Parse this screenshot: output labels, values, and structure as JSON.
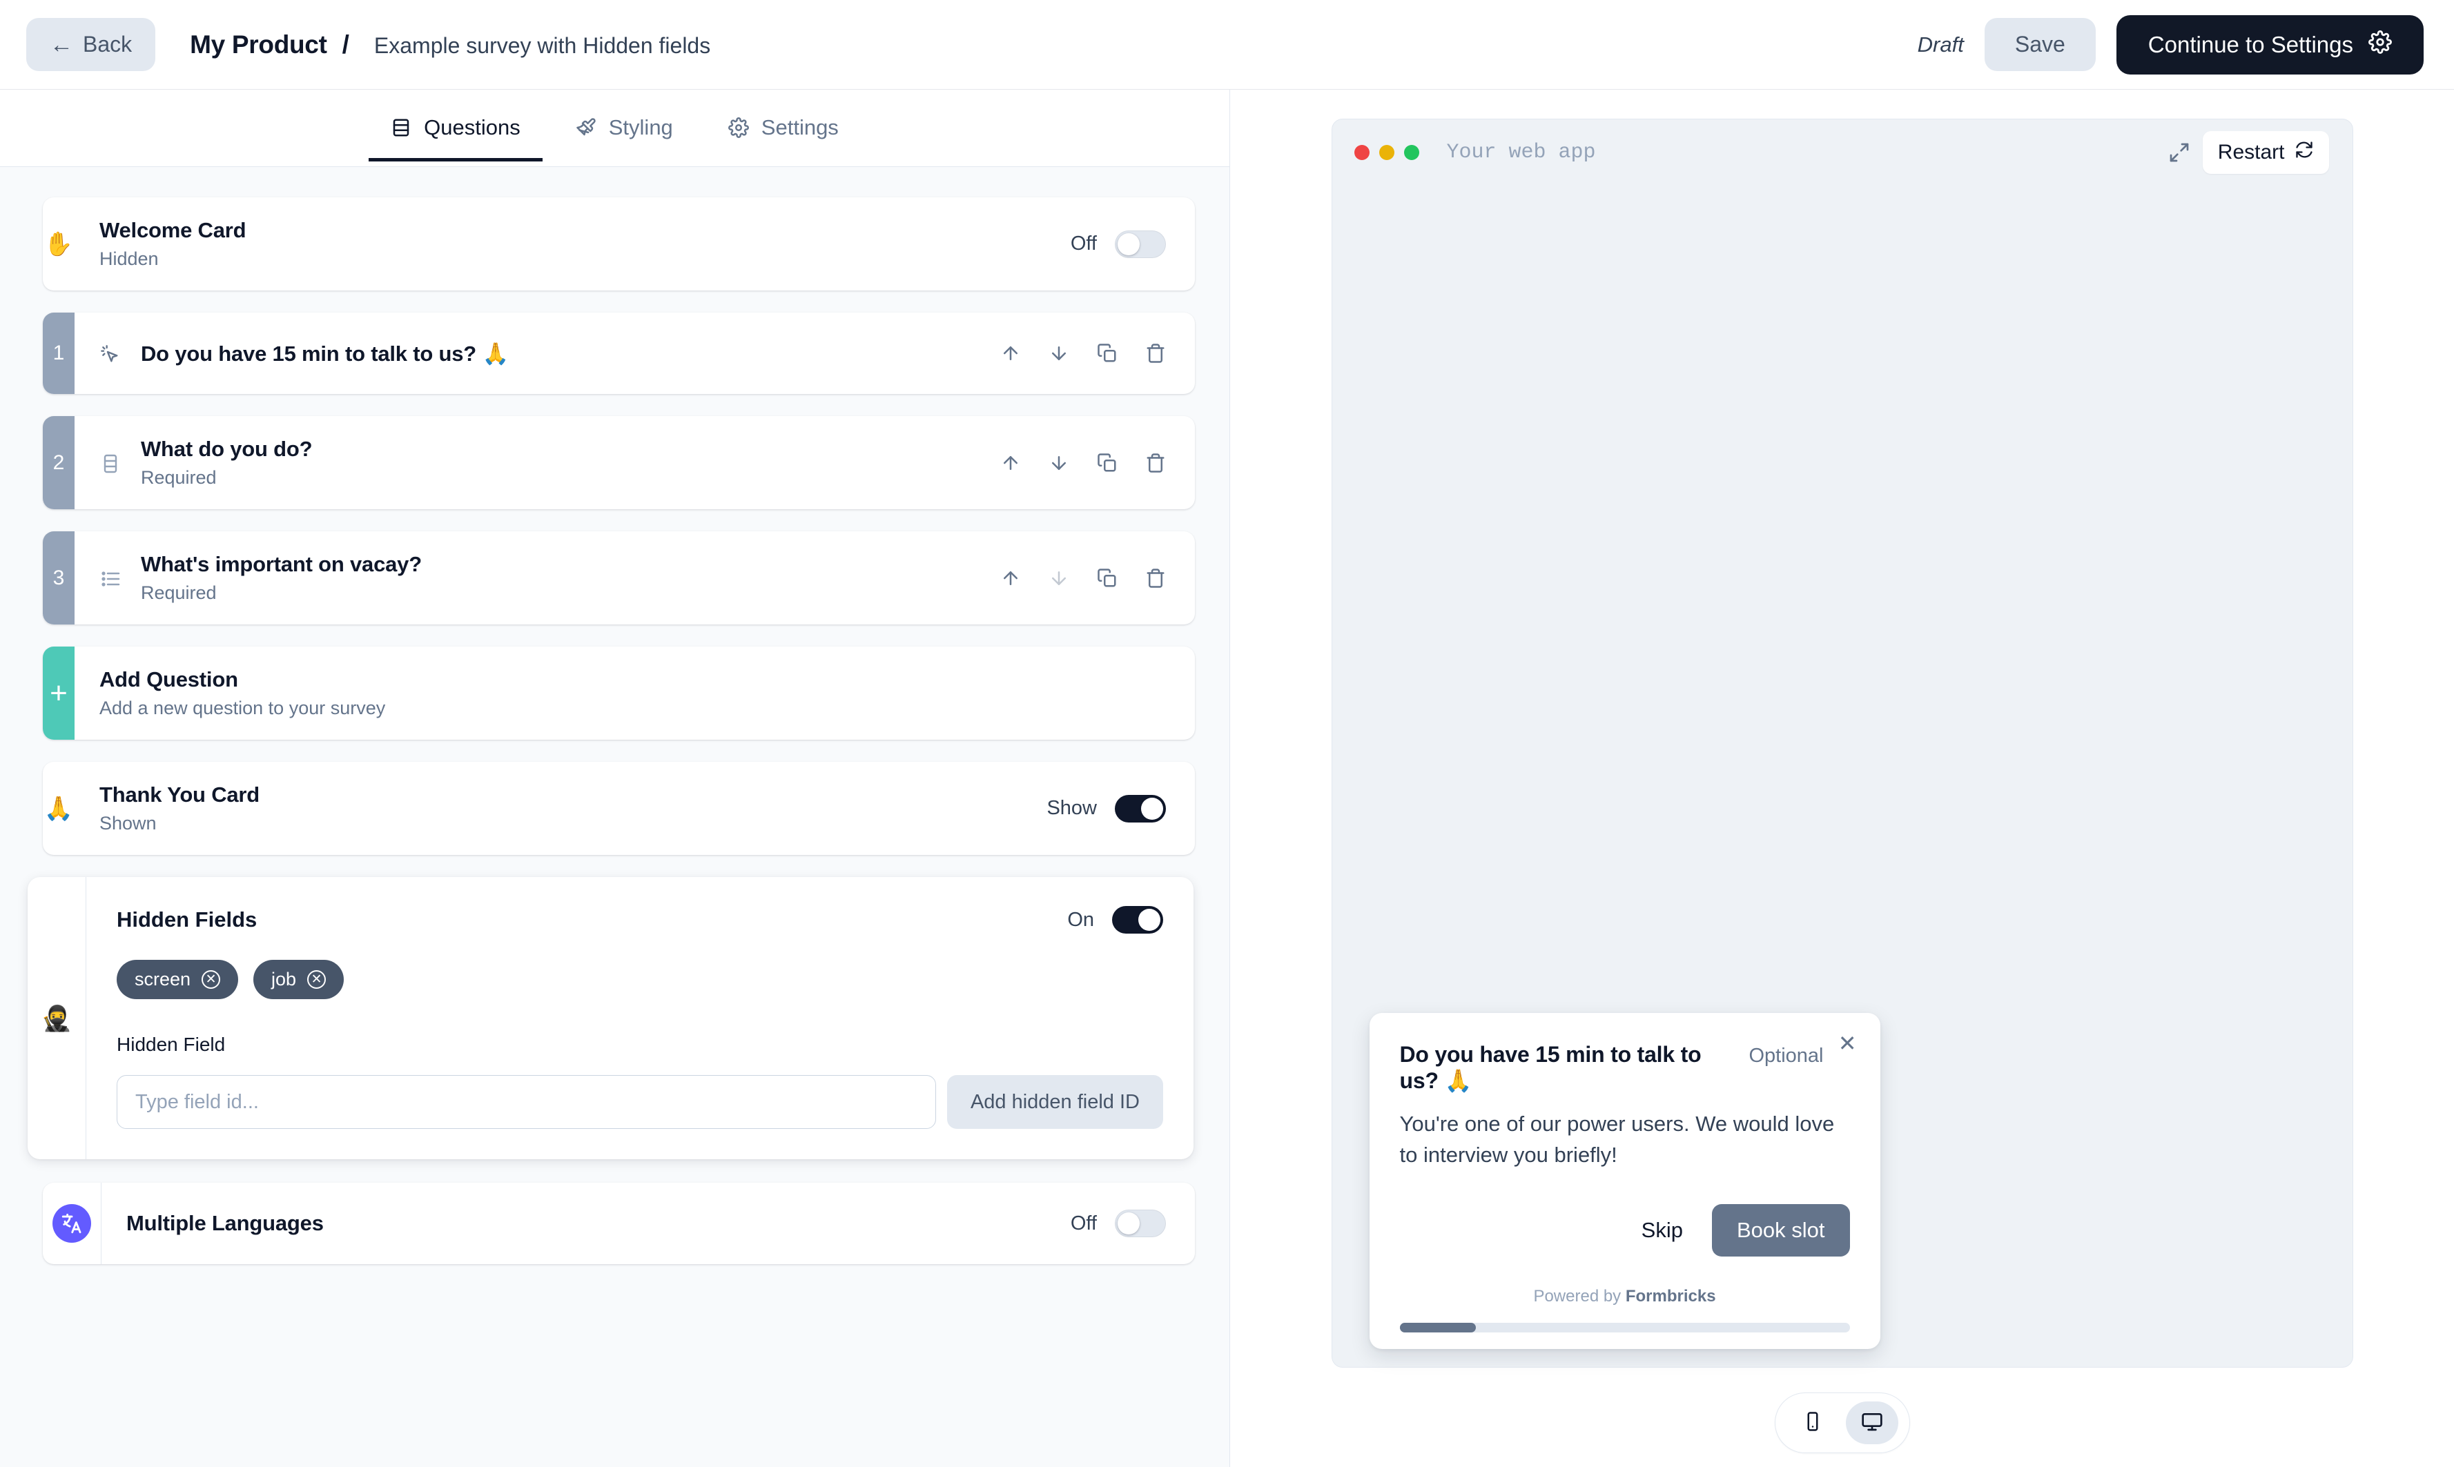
{
  "header": {
    "back_label": "Back",
    "back_icon": "arrow-left-icon",
    "product": "My Product",
    "separator": "/",
    "survey_name": "Example survey with Hidden fields",
    "status": "Draft",
    "save_label": "Save",
    "continue_label": "Continue to Settings",
    "continue_icon": "gear-icon"
  },
  "tabs": [
    {
      "label": "Questions",
      "icon": "rows-icon",
      "active": true
    },
    {
      "label": "Styling",
      "icon": "paintbrush-icon",
      "active": false
    },
    {
      "label": "Settings",
      "icon": "gear-icon",
      "active": false
    }
  ],
  "welcome_card": {
    "emoji": "✋",
    "title": "Welcome Card",
    "subtitle": "Hidden",
    "toggle_label": "Off",
    "toggle_on": false
  },
  "questions": [
    {
      "number": "1",
      "icon": "cta-pointer-icon",
      "title": "Do you have 15 min to talk to us? 🙏",
      "subtitle": "",
      "up_disabled": false,
      "down_disabled": false
    },
    {
      "number": "2",
      "icon": "rating-rows-icon",
      "title": "What do you do?",
      "subtitle": "Required",
      "up_disabled": false,
      "down_disabled": false
    },
    {
      "number": "3",
      "icon": "list-icon",
      "title": "What's important on vacay?",
      "subtitle": "Required",
      "up_disabled": false,
      "down_disabled": true
    }
  ],
  "question_actions": {
    "move_up": "arrow-up-icon",
    "move_down": "arrow-down-icon",
    "duplicate": "copy-icon",
    "delete": "trash-icon"
  },
  "add_question": {
    "icon": "plus-icon",
    "title": "Add Question",
    "subtitle": "Add a new question to your survey"
  },
  "thank_you_card": {
    "emoji": "🙏",
    "title": "Thank You Card",
    "subtitle": "Shown",
    "toggle_label": "Show",
    "toggle_on": true
  },
  "hidden_fields": {
    "emoji": "🥷",
    "title": "Hidden Fields",
    "toggle_label": "On",
    "toggle_on": true,
    "chips": [
      "screen",
      "job"
    ],
    "field_label": "Hidden Field",
    "input_placeholder": "Type field id...",
    "input_value": "",
    "add_button": "Add hidden field ID"
  },
  "multiple_languages": {
    "icon": "translate-icon",
    "icon_color": "#635bff",
    "title": "Multiple Languages",
    "toggle_label": "Off",
    "toggle_on": false
  },
  "preview": {
    "window_title": "Your web app",
    "dots": [
      "#ef4444",
      "#eab308",
      "#22c55e"
    ],
    "expand_icon": "maximize-icon",
    "restart_label": "Restart",
    "restart_icon": "refresh-icon",
    "survey": {
      "close_icon": "close-icon",
      "question": "Do you have 15 min to talk to us? 🙏",
      "optional_label": "Optional",
      "description": "You're one of our power users. We would love to interview you briefly!",
      "skip_label": "Skip",
      "submit_label": "Book slot",
      "powered_prefix": "Powered by ",
      "powered_brand": "Formbricks",
      "progress_percent": 17
    },
    "device_switch": [
      {
        "icon": "mobile-icon",
        "active": false
      },
      {
        "icon": "desktop-icon",
        "active": true
      }
    ]
  }
}
